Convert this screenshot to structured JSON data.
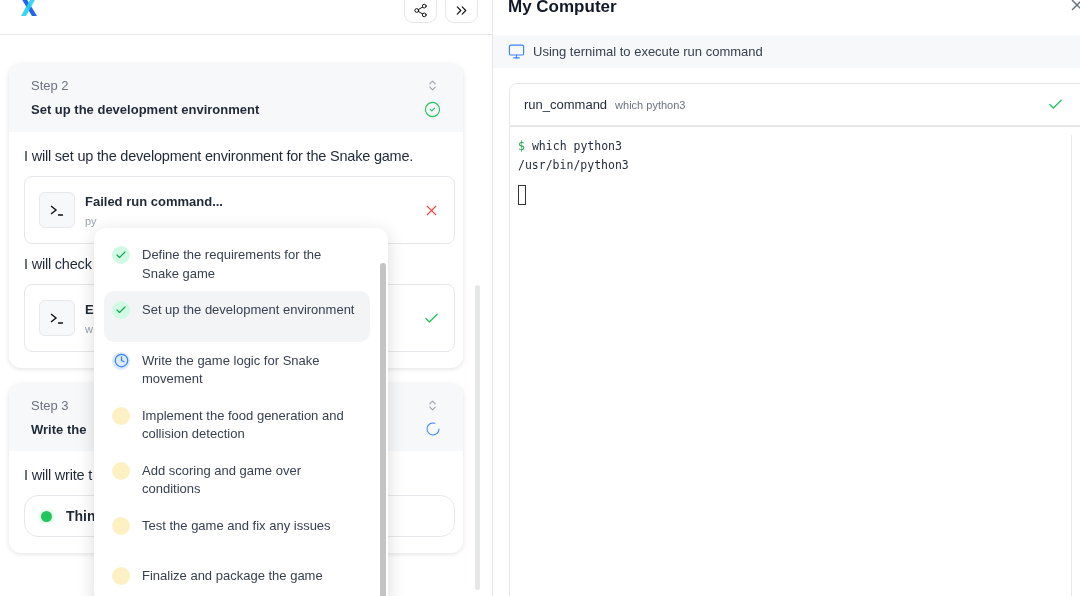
{
  "steps": [
    {
      "label": "Step 2",
      "title": "Set up the development environment",
      "done": true,
      "body": [
        {
          "kind": "text",
          "text": "I will set up the development environment for the Snake game."
        },
        {
          "kind": "command",
          "title": "Failed run command...",
          "detail": "py",
          "failed": true
        },
        {
          "kind": "text",
          "text": "I will check"
        },
        {
          "kind": "command",
          "title": "E",
          "detail": "w",
          "failed": false
        }
      ]
    },
    {
      "label": "Step 3",
      "title": "Write the",
      "done": false,
      "body": [
        {
          "kind": "text",
          "text": "I will write t"
        },
        {
          "kind": "thinking",
          "text": "Thin"
        }
      ]
    }
  ],
  "plan": [
    {
      "text": "Define the requirements for the Snake game",
      "kind": "done",
      "selected": false
    },
    {
      "text": "Set up the development environment",
      "kind": "done",
      "selected": true
    },
    {
      "text": "Write the game logic for Snake movement",
      "kind": "active",
      "selected": false
    },
    {
      "text": "Implement the food generation and collision detection",
      "kind": "pending",
      "selected": false
    },
    {
      "text": "Add scoring and game over conditions",
      "kind": "pending",
      "selected": false
    },
    {
      "text": "Test the game and fix any issues",
      "kind": "pending",
      "selected": false
    },
    {
      "text": "Finalize and package the game",
      "kind": "pending",
      "selected": false
    }
  ],
  "computer": {
    "title": "My Computer",
    "info": "Using ternimal to execute run command",
    "tool": {
      "name": "run_command",
      "arg": "which python3",
      "failed": false
    },
    "terminal": [
      {
        "kind": "prompt",
        "prompt": "$",
        "text": "which python3"
      },
      {
        "kind": "output",
        "text": "/usr/bin/python3"
      }
    ]
  }
}
